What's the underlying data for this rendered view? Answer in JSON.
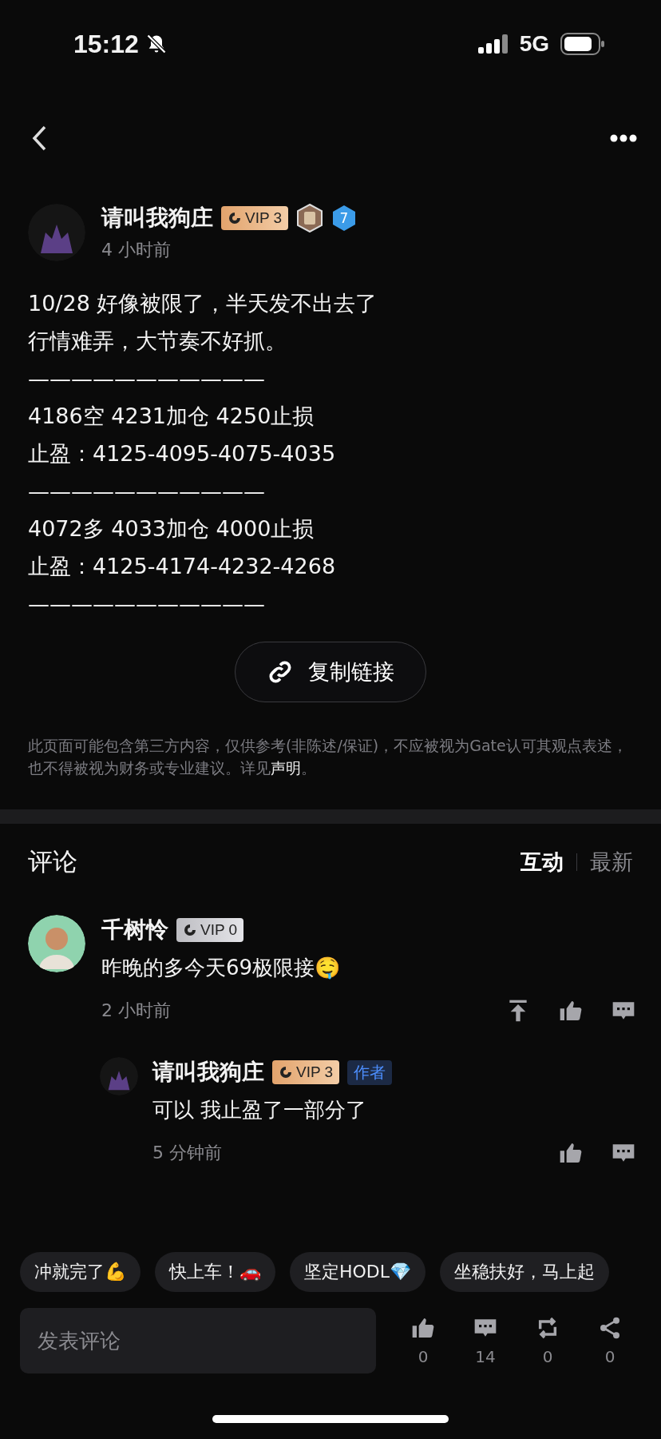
{
  "status_bar": {
    "time": "15:12",
    "network": "5G"
  },
  "post": {
    "author": {
      "name": "请叫我狗庄",
      "vip": {
        "label": "VIP 3",
        "kind": "gold"
      },
      "level": "7"
    },
    "time": "4 小时前",
    "lines": [
      "10/28 好像被限了，半天发不出去了",
      "行情难弄，大节奏不好抓。",
      "———————————",
      "4186空 4231加仓 4250止损",
      "止盈：4125-4095-4075-4035",
      "———————————",
      "4072多 4033加仓  4000止损",
      "止盈：4125-4174-4232-4268",
      "———————————"
    ],
    "copy_link": "复制链接",
    "disclaimer": {
      "text": "此页面可能包含第三方内容，仅供参考(非陈述/保证)，不应被视为Gate认可其观点表述，也不得被视为财务或专业建议。详见",
      "link": "声明",
      "end": "。"
    }
  },
  "comments": {
    "title": "评论",
    "sorts": [
      {
        "label": "互动",
        "selected": true
      },
      {
        "label": "最新",
        "selected": false
      }
    ],
    "items": [
      {
        "name": "千树怜",
        "vip": {
          "label": "VIP 0",
          "kind": "silver"
        },
        "text": "昨晚的多今天69极限接🤤",
        "time": "2 小时前",
        "avatar": {
          "kind": "person"
        },
        "pin": true,
        "replies": [
          {
            "name": "请叫我狗庄",
            "vip": {
              "label": "VIP 3",
              "kind": "gold"
            },
            "tag": "作者",
            "text": "可以 我止盈了一部分了",
            "time": "5 分钟前",
            "avatar": {
              "kind": "dark"
            },
            "pin": false
          }
        ]
      }
    ]
  },
  "quick_replies": [
    "冲就完了💪",
    "快上车！🚗",
    "坚定HODL💎",
    "坐稳扶好，马上起"
  ],
  "composer": {
    "placeholder": "发表评论"
  },
  "actions": [
    {
      "kind": "like",
      "count": "0"
    },
    {
      "kind": "comment",
      "count": "14"
    },
    {
      "kind": "repost",
      "count": "0"
    },
    {
      "kind": "share",
      "count": "0"
    }
  ]
}
